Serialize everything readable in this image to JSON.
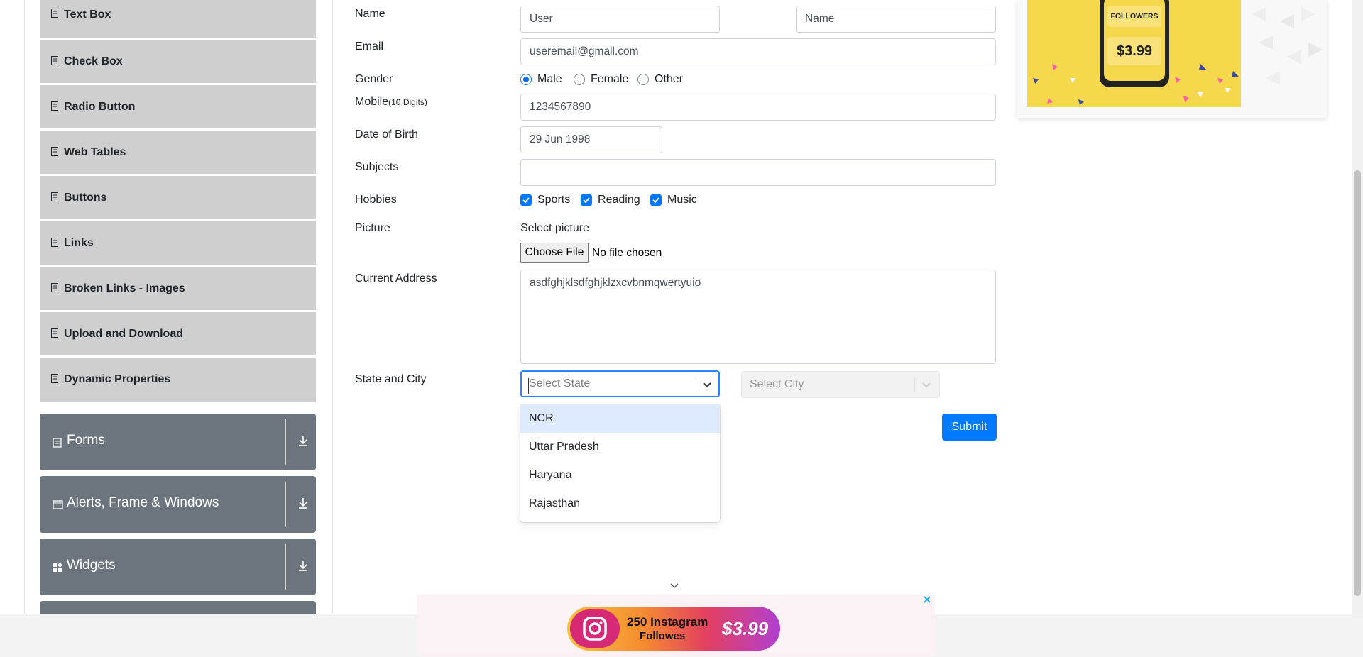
{
  "sidebar": {
    "items": [
      {
        "label": "Text Box"
      },
      {
        "label": "Check Box"
      },
      {
        "label": "Radio Button"
      },
      {
        "label": "Web Tables"
      },
      {
        "label": "Buttons"
      },
      {
        "label": "Links"
      },
      {
        "label": "Broken Links - Images"
      },
      {
        "label": "Upload and Download"
      },
      {
        "label": "Dynamic Properties"
      }
    ],
    "groups": [
      {
        "label": "Forms"
      },
      {
        "label": "Alerts, Frame & Windows"
      },
      {
        "label": "Widgets"
      }
    ]
  },
  "form": {
    "name_label": "Name",
    "first_name": "User",
    "last_name": "Name",
    "email_label": "Email",
    "email": "useremail@gmail.com",
    "gender_label": "Gender",
    "gender_options": [
      "Male",
      "Female",
      "Other"
    ],
    "gender_selected": "Male",
    "mobile_label": "Mobile",
    "mobile_hint": "(10 Digits)",
    "mobile": "1234567890",
    "dob_label": "Date of Birth",
    "dob": "29 Jun 1998",
    "subjects_label": "Subjects",
    "hobbies_label": "Hobbies",
    "hobbies": [
      "Sports",
      "Reading",
      "Music"
    ],
    "picture_label": "Picture",
    "select_picture": "Select picture",
    "choose_file": "Choose File",
    "no_file": "No file chosen",
    "address_label": "Current Address",
    "address": "asdfghjklsdfghjklzxcvbnmqwertyuio",
    "state_city_label": "State and City",
    "state_placeholder": "Select State",
    "city_placeholder": "Select City",
    "state_options": [
      "NCR",
      "Uttar Pradesh",
      "Haryana",
      "Rajasthan"
    ],
    "submit": "Submit"
  },
  "ad_right": {
    "followers": "FOLLOWERS",
    "price": "$3.99"
  },
  "ad_bottom": {
    "text_line1": "250 Instagram",
    "text_line2": "Followes",
    "price": "$3.99"
  },
  "colors": {
    "accent": "#007bff",
    "sidebar_item": "#cfcfcf",
    "group": "#6c757d",
    "ad_yellow": "#f6d84d"
  }
}
